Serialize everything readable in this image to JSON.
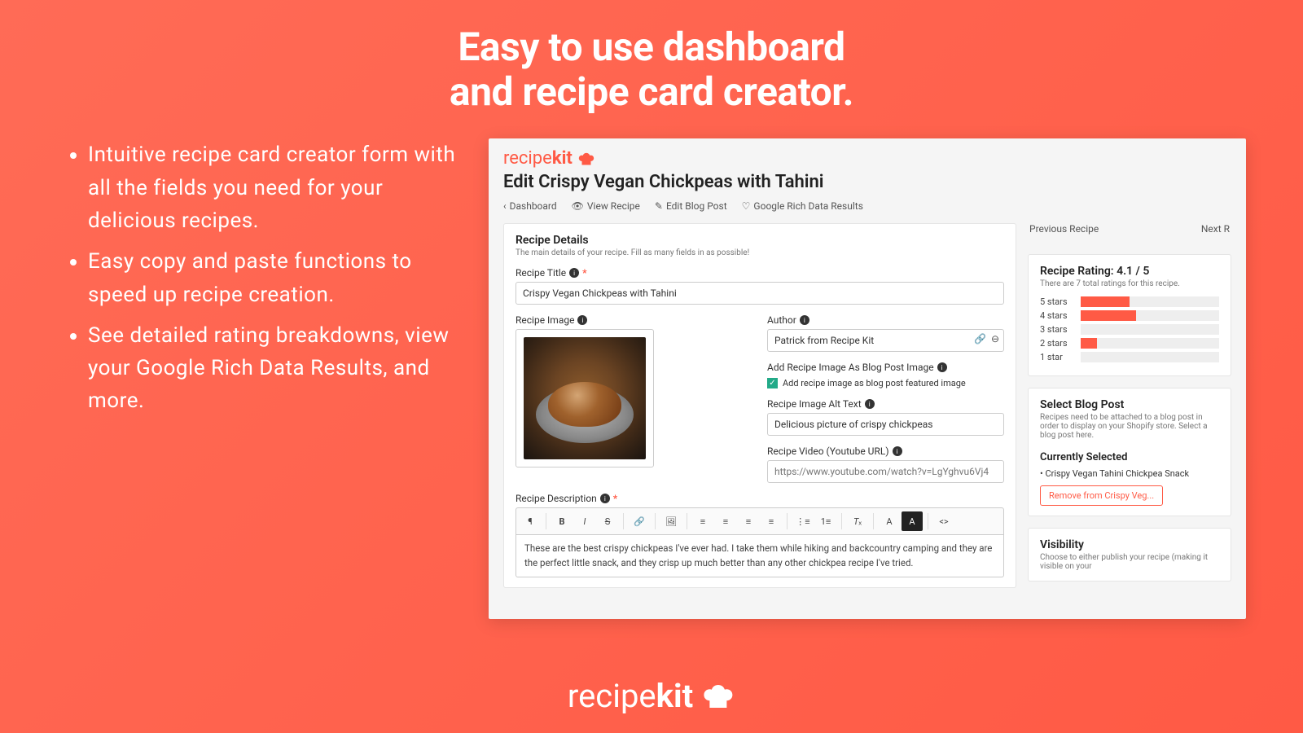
{
  "hero": {
    "line1": "Easy to use dashboard",
    "line2": "and recipe card creator."
  },
  "bullets": [
    "Intuitive recipe card creator form with all the fields you need for your delicious recipes.",
    "Easy copy and paste functions to speed up recipe creation.",
    "See detailed rating breakdowns, view your Google Rich Data Results, and more."
  ],
  "footer_brand": {
    "a": "recipe",
    "b": "kit"
  },
  "app": {
    "brand": {
      "a": "recipe",
      "b": "kit"
    },
    "page_title": "Edit Crispy Vegan Chickpeas with Tahini",
    "toolbar": {
      "dashboard": "Dashboard",
      "view_recipe": "View Recipe",
      "edit_blog": "Edit Blog Post",
      "google_rich": "Google Rich Data Results"
    },
    "details": {
      "heading": "Recipe Details",
      "sub": "The main details of your recipe. Fill as many fields in as possible!",
      "title_label": "Recipe Title",
      "title_value": "Crispy Vegan Chickpeas with Tahini",
      "image_label": "Recipe Image",
      "author_label": "Author",
      "author_value": "Patrick from Recipe Kit",
      "add_image_label": "Add Recipe Image As Blog Post Image",
      "add_image_check": "Add recipe image as blog post featured image",
      "alt_label": "Recipe Image Alt Text",
      "alt_value": "Delicious picture of crispy chickpeas",
      "video_label": "Recipe Video (Youtube URL)",
      "video_placeholder": "https://www.youtube.com/watch?v=LgYghvu6Vj4",
      "desc_label": "Recipe Description",
      "desc_value": "These are the best crispy chickpeas I've ever had. I take them while hiking and backcountry camping and they are the perfect little snack, and they crisp up much better than any other chickpea recipe I've tried."
    },
    "nav": {
      "prev": "Previous Recipe",
      "next": "Next R"
    },
    "rating": {
      "heading": "Recipe Rating: 4.1 / 5",
      "sub": "There are 7 total ratings for this recipe.",
      "rows": [
        {
          "label": "5 stars",
          "pct": 35
        },
        {
          "label": "4 stars",
          "pct": 40
        },
        {
          "label": "3 stars",
          "pct": 0
        },
        {
          "label": "2 stars",
          "pct": 12
        },
        {
          "label": "1 star",
          "pct": 0
        }
      ]
    },
    "blog": {
      "heading": "Select Blog Post",
      "sub": "Recipes need to be attached to a blog post in order to display on your Shopify store. Select a blog post here.",
      "cs_heading": "Currently Selected",
      "cs_item": "Crispy Vegan Tahini Chickpea Snack",
      "remove": "Remove from Crispy Veg..."
    },
    "visibility": {
      "heading": "Visibility",
      "sub": "Choose to either publish your recipe (making it visible on your"
    }
  }
}
